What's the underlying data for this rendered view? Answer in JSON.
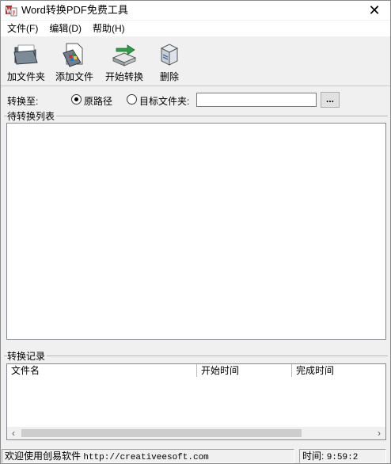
{
  "window": {
    "title": "Word转换PDF免费工具",
    "close_glyph": "✕"
  },
  "menu": [
    "文件(F)",
    "编辑(D)",
    "帮助(H)"
  ],
  "toolbar": {
    "add_folder": "加文件夹",
    "add_file": "添加文件",
    "start": "开始转换",
    "delete": "删除"
  },
  "target": {
    "label": "转换至:",
    "option_original": "原路径",
    "option_folder": "目标文件夹:",
    "selected": "original",
    "path_value": "",
    "browse_label": "..."
  },
  "queue": {
    "title": "待转换列表"
  },
  "log": {
    "title": "转换记录",
    "columns": [
      "文件名",
      "开始时间",
      "完成时间"
    ]
  },
  "status": {
    "message_prefix": "欢迎使用创易软件",
    "url": "http://creativeesoft.com",
    "time_label": "时间:",
    "time_value": "9:59:2"
  },
  "icons": {
    "app": "word-to-pdf-icon",
    "add_folder": "folder-icon",
    "add_file": "add-document-icon",
    "start": "convert-arrow-icon",
    "delete": "delete-box-icon"
  }
}
